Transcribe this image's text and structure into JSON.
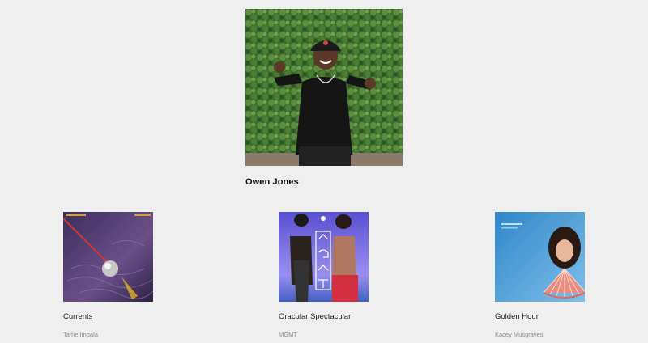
{
  "profile": {
    "name": "Owen Jones",
    "photo_icon": "person-photo"
  },
  "albums": [
    {
      "title": "Currents",
      "artist": "Tame Impala",
      "cover_icon": "album-cover-currents"
    },
    {
      "title": "Oracular Spectacular",
      "artist": "MGMT",
      "cover_icon": "album-cover-oracular"
    },
    {
      "title": "Golden Hour",
      "artist": "Kacey Musgraves",
      "cover_icon": "album-cover-golden-hour"
    }
  ],
  "colors": {
    "background": "#efefef",
    "artist_text": "#8a8a8a"
  }
}
